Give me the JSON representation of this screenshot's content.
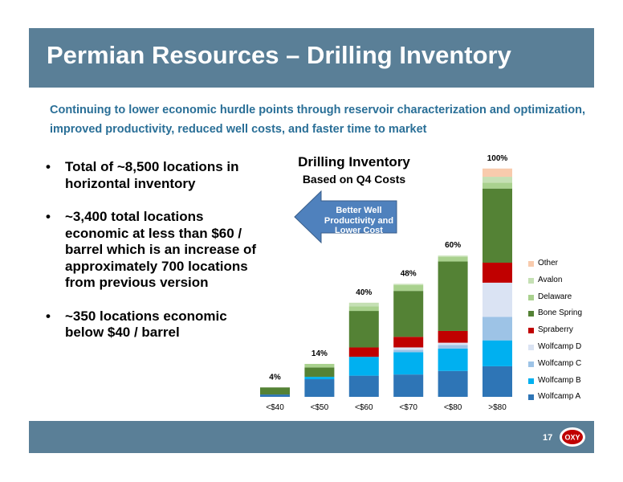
{
  "header": {
    "title": "Permian Resources – Drilling Inventory"
  },
  "subtitle": "Continuing to lower economic hurdle points through reservoir characterization and optimization, improved productivity, reduced well costs, and faster time to market",
  "bullets": [
    {
      "marker": "•",
      "text": "Total of ~8,500 locations in horizontal inventory"
    },
    {
      "marker": "•",
      "text": "~3,400 total locations economic at less than $60 / barrel which is an increase of  approximately 700 locations from previous version"
    },
    {
      "marker": "•",
      "text": "~350 locations economic below $40 / barrel"
    }
  ],
  "chart_title": {
    "line1": "Drilling Inventory",
    "line2": "Based on Q4 Costs"
  },
  "arrow_label": {
    "line1": "Better Well",
    "line2": "Productivity and",
    "line3": "Lower Cost"
  },
  "chart_data": {
    "type": "bar",
    "stacked": true,
    "title": "Drilling Inventory",
    "subtitle": "Based on Q4 Costs",
    "categories": [
      "<$40",
      "<$50",
      "<$60",
      "<$70",
      "<$80",
      ">$80"
    ],
    "totals": [
      "4%",
      "14%",
      "40%",
      "48%",
      "60%",
      "100%"
    ],
    "total_values": [
      4,
      14,
      40,
      48,
      60,
      100
    ],
    "series": [
      {
        "name": "Wolfcamp A",
        "color": "#2e75b6",
        "values": [
          1.0,
          7.5,
          9.0,
          9.5,
          11.0,
          13.0
        ]
      },
      {
        "name": "Wolfcamp B",
        "color": "#00b0f0",
        "values": [
          0,
          1.0,
          8.0,
          9.5,
          9.5,
          11.0
        ]
      },
      {
        "name": "Wolfcamp C",
        "color": "#9dc3e6",
        "values": [
          0,
          0,
          0,
          1.0,
          1.5,
          10.0
        ]
      },
      {
        "name": "Wolfcamp D",
        "color": "#dae3f3",
        "values": [
          0,
          0,
          0,
          1.0,
          1.0,
          14.5
        ]
      },
      {
        "name": "Spraberry",
        "color": "#c00000",
        "values": [
          0,
          0,
          4.0,
          4.5,
          5.0,
          8.5
        ]
      },
      {
        "name": "Bone Spring",
        "color": "#548235",
        "values": [
          3.0,
          4.0,
          15.5,
          19.5,
          29.5,
          31.5
        ]
      },
      {
        "name": "Delaware",
        "color": "#a9d18e",
        "values": [
          0,
          1.5,
          2.0,
          2.5,
          2.0,
          2.5
        ]
      },
      {
        "name": "Avalon",
        "color": "#c5e0b4",
        "values": [
          0,
          0,
          1.5,
          0.5,
          0.5,
          2.5
        ]
      },
      {
        "name": "Other",
        "color": "#f8cbad",
        "values": [
          0,
          0,
          0,
          0,
          0,
          3.5
        ]
      }
    ],
    "legend_order": [
      "Other",
      "Avalon",
      "Delaware",
      "Bone Spring",
      "Spraberry",
      "Wolfcamp D",
      "Wolfcamp C",
      "Wolfcamp B",
      "Wolfcamp A"
    ],
    "ylim": [
      0,
      100
    ],
    "grid": false,
    "legend_position": "right"
  },
  "footer": {
    "page_number": "17",
    "logo": "oxy-logo"
  },
  "colors": {
    "header_bg": "#5a7f97",
    "subtitle_text": "#2a6f97",
    "arrow_fill": "#4f81bd"
  }
}
